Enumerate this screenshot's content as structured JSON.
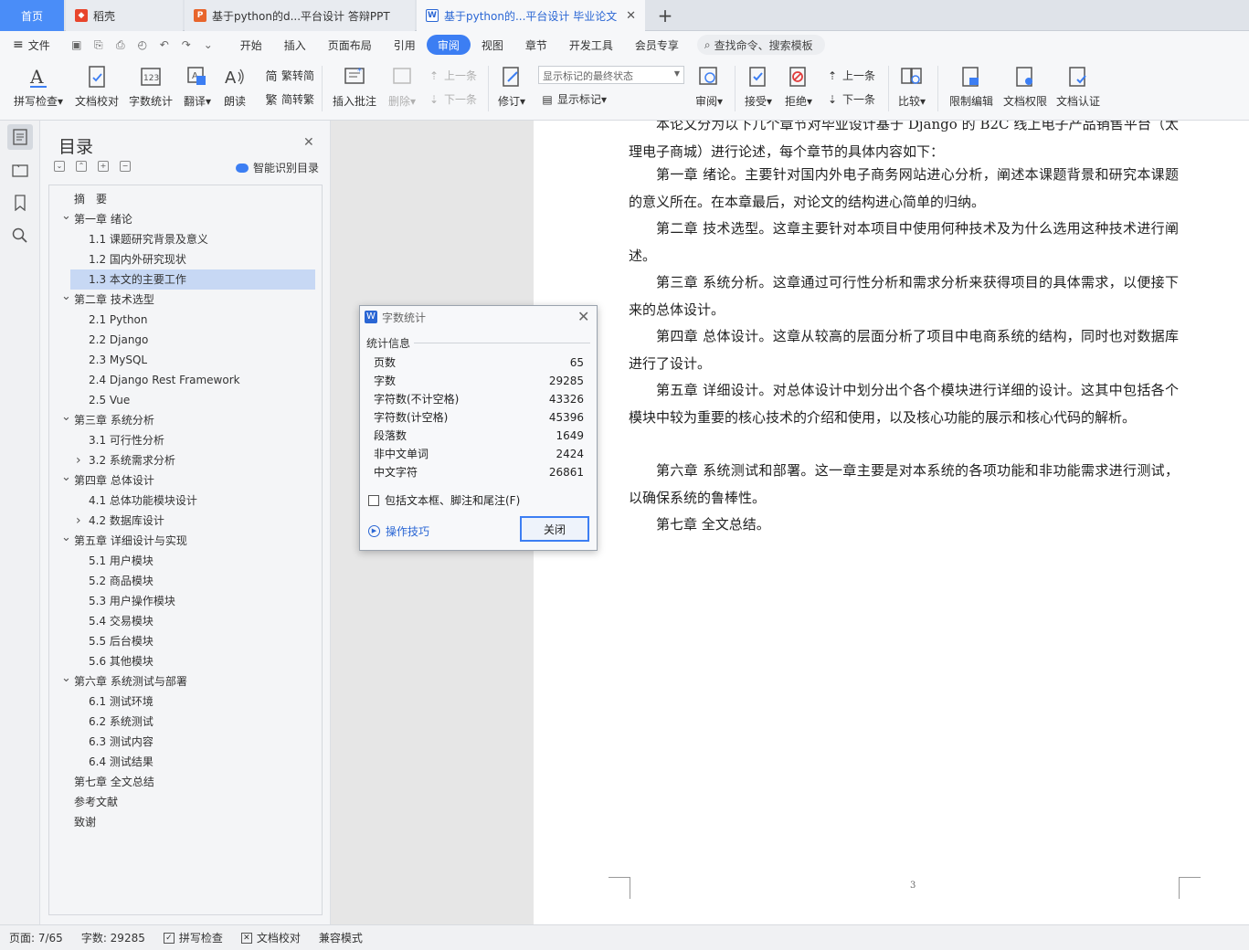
{
  "tabs": {
    "home": "首页",
    "t1": "稻壳",
    "t2": "基于python的d...平台设计 答辩PPT",
    "t3": "基于python的...平台设计 毕业论文"
  },
  "menu": {
    "file": "文件",
    "items": [
      "开始",
      "插入",
      "页面布局",
      "引用",
      "审阅",
      "视图",
      "章节",
      "开发工具",
      "会员专享"
    ],
    "search": "查找命令、搜索模板"
  },
  "ribbon": {
    "spell": "拼写检查",
    "proof": "文档校对",
    "wordcount": "字数统计",
    "translate": "翻译",
    "read": "朗读",
    "trad": "繁转简",
    "simp": "简转繁",
    "insert_comment": "插入批注",
    "delete": "删除",
    "prev1": "上一条",
    "next1": "下一条",
    "revise": "修订",
    "markup_state": "显示标记的最终状态",
    "show_markup": "显示标记",
    "review": "审阅",
    "accept": "接受",
    "reject": "拒绝",
    "prev2": "上一条",
    "next2": "下一条",
    "compare": "比较",
    "restrict": "限制编辑",
    "permission": "文档权限",
    "certify": "文档认证"
  },
  "toc": {
    "title": "目录",
    "smart": "智能识别目录",
    "items": [
      {
        "label": "摘　要",
        "level": 1,
        "chev": ""
      },
      {
        "label": "第一章  绪论",
        "level": 1,
        "chev": "v"
      },
      {
        "label": "1.1  课题研究背景及意义",
        "level": 2,
        "chev": ""
      },
      {
        "label": "1.2  国内外研究现状",
        "level": 2,
        "chev": ""
      },
      {
        "label": "1.3  本文的主要工作",
        "level": 2,
        "chev": "",
        "selected": true
      },
      {
        "label": "第二章  技术选型",
        "level": 1,
        "chev": "v"
      },
      {
        "label": "2.1 Python",
        "level": 2,
        "chev": ""
      },
      {
        "label": "2.2 Django",
        "level": 2,
        "chev": ""
      },
      {
        "label": "2.3 MySQL",
        "level": 2,
        "chev": ""
      },
      {
        "label": "2.4 Django Rest Framework",
        "level": 2,
        "chev": ""
      },
      {
        "label": "2.5 Vue",
        "level": 2,
        "chev": ""
      },
      {
        "label": "第三章  系统分析",
        "level": 1,
        "chev": "v"
      },
      {
        "label": "3.1  可行性分析",
        "level": 2,
        "chev": ""
      },
      {
        "label": "3.2  系统需求分析",
        "level": 2,
        "chev": ">"
      },
      {
        "label": "第四章  总体设计",
        "level": 1,
        "chev": "v"
      },
      {
        "label": "4.1  总体功能模块设计",
        "level": 2,
        "chev": ""
      },
      {
        "label": "4.2  数据库设计",
        "level": 2,
        "chev": ">"
      },
      {
        "label": "第五章  详细设计与实现",
        "level": 1,
        "chev": "v"
      },
      {
        "label": "5.1  用户模块",
        "level": 2,
        "chev": ""
      },
      {
        "label": "5.2  商品模块",
        "level": 2,
        "chev": ""
      },
      {
        "label": "5.3  用户操作模块",
        "level": 2,
        "chev": ""
      },
      {
        "label": "5.4  交易模块",
        "level": 2,
        "chev": ""
      },
      {
        "label": "5.5  后台模块",
        "level": 2,
        "chev": ""
      },
      {
        "label": "5.6  其他模块",
        "level": 2,
        "chev": ""
      },
      {
        "label": "第六章  系统测试与部署",
        "level": 1,
        "chev": "v"
      },
      {
        "label": "6.1  测试环境",
        "level": 2,
        "chev": ""
      },
      {
        "label": "6.2  系统测试",
        "level": 2,
        "chev": ""
      },
      {
        "label": "6.3  测试内容",
        "level": 2,
        "chev": ""
      },
      {
        "label": "6.4  测试结果",
        "level": 2,
        "chev": ""
      },
      {
        "label": "第七章  全文总结",
        "level": 1,
        "chev": ""
      },
      {
        "label": "参考文献",
        "level": 1,
        "chev": ""
      },
      {
        "label": "致谢",
        "level": 1,
        "chev": ""
      }
    ]
  },
  "doc": {
    "paragraphs": [
      "本论文分为以下几个章节对毕业设计基于 Django 的 B2C 线上电子产品销售平台（太理电子商城）进行论述，每个章节的具体内容如下：",
      "第一章  绪论。主要针对国内外电子商务网站进心分析，阐述本课题背景和研究本课题的意义所在。在本章最后，对论文的结构进心简单的归纳。",
      "第二章  技术选型。这章主要针对本项目中使用何种技术及为什么选用这种技术进行阐述。",
      "第三章  系统分析。这章通过可行性分析和需求分析来获得项目的具体需求，以便接下来的总体设计。",
      "第四章  总体设计。这章从较高的层面分析了项目中电商系统的结构，同时也对数据库进行了设计。",
      "第五章  详细设计。对总体设计中划分出个各个模块进行详细的设计。这其中包括各个模块中较为重要的核心技术的介绍和使用，以及核心功能的展示和核心代码的解析。",
      "第六章  系统测试和部署。这一章主要是对本系统的各项功能和非功能需求进行测试，以确保系统的鲁棒性。",
      "第七章  全文总结。"
    ],
    "page_number": "3"
  },
  "dialog": {
    "title": "字数统计",
    "section": "统计信息",
    "stats": [
      {
        "label": "页数",
        "value": "65"
      },
      {
        "label": "字数",
        "value": "29285"
      },
      {
        "label": "字符数(不计空格)",
        "value": "43326"
      },
      {
        "label": "字符数(计空格)",
        "value": "45396"
      },
      {
        "label": "段落数",
        "value": "1649"
      },
      {
        "label": "非中文单词",
        "value": "2424"
      },
      {
        "label": "中文字符",
        "value": "26861"
      }
    ],
    "include_label": "包括文本框、脚注和尾注(F)",
    "tips": "操作技巧",
    "close_btn": "关闭"
  },
  "status": {
    "page": "页面: 7/65",
    "words": "字数: 29285",
    "spell": "拼写检查",
    "proof": "文档校对",
    "compat": "兼容模式"
  },
  "colors": {
    "accent": "#3c7ef3",
    "selected": "#c7d8f4"
  }
}
